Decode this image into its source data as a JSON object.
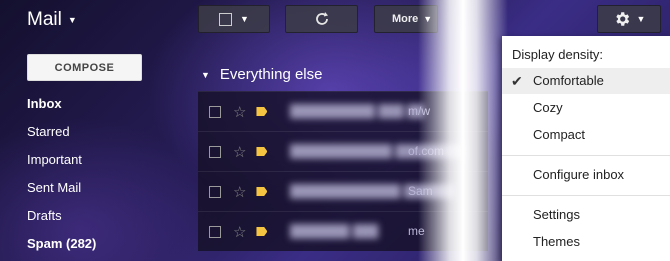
{
  "app": {
    "title": "Mail"
  },
  "toolbar": {
    "more_label": "More"
  },
  "compose_label": "COMPOSE",
  "nav": {
    "items": [
      {
        "label": "Inbox",
        "bold": true
      },
      {
        "label": "Starred",
        "bold": false
      },
      {
        "label": "Important",
        "bold": false
      },
      {
        "label": "Sent Mail",
        "bold": false
      },
      {
        "label": "Drafts",
        "bold": false
      },
      {
        "label": "Spam (282)",
        "bold": true
      }
    ]
  },
  "section": {
    "title": "Everything else"
  },
  "rows": [
    {
      "snippet": "m/w"
    },
    {
      "snippet": "of.com"
    },
    {
      "snippet": "Sam"
    },
    {
      "snippet": "me"
    }
  ],
  "menu": {
    "density_label": "Display density:",
    "density_options": [
      "Comfortable",
      "Cozy",
      "Compact"
    ],
    "selected_density": "Comfortable",
    "configure_label": "Configure inbox",
    "settings_label": "Settings",
    "themes_label": "Themes"
  },
  "icons": {
    "refresh": "refresh-icon",
    "gear": "gear-icon",
    "check": "check-icon",
    "star": "star-icon",
    "label_tag": "label-tag-icon"
  },
  "colors": {
    "label_tag": "#f5c542",
    "menu_selected": "#eeeeee"
  }
}
